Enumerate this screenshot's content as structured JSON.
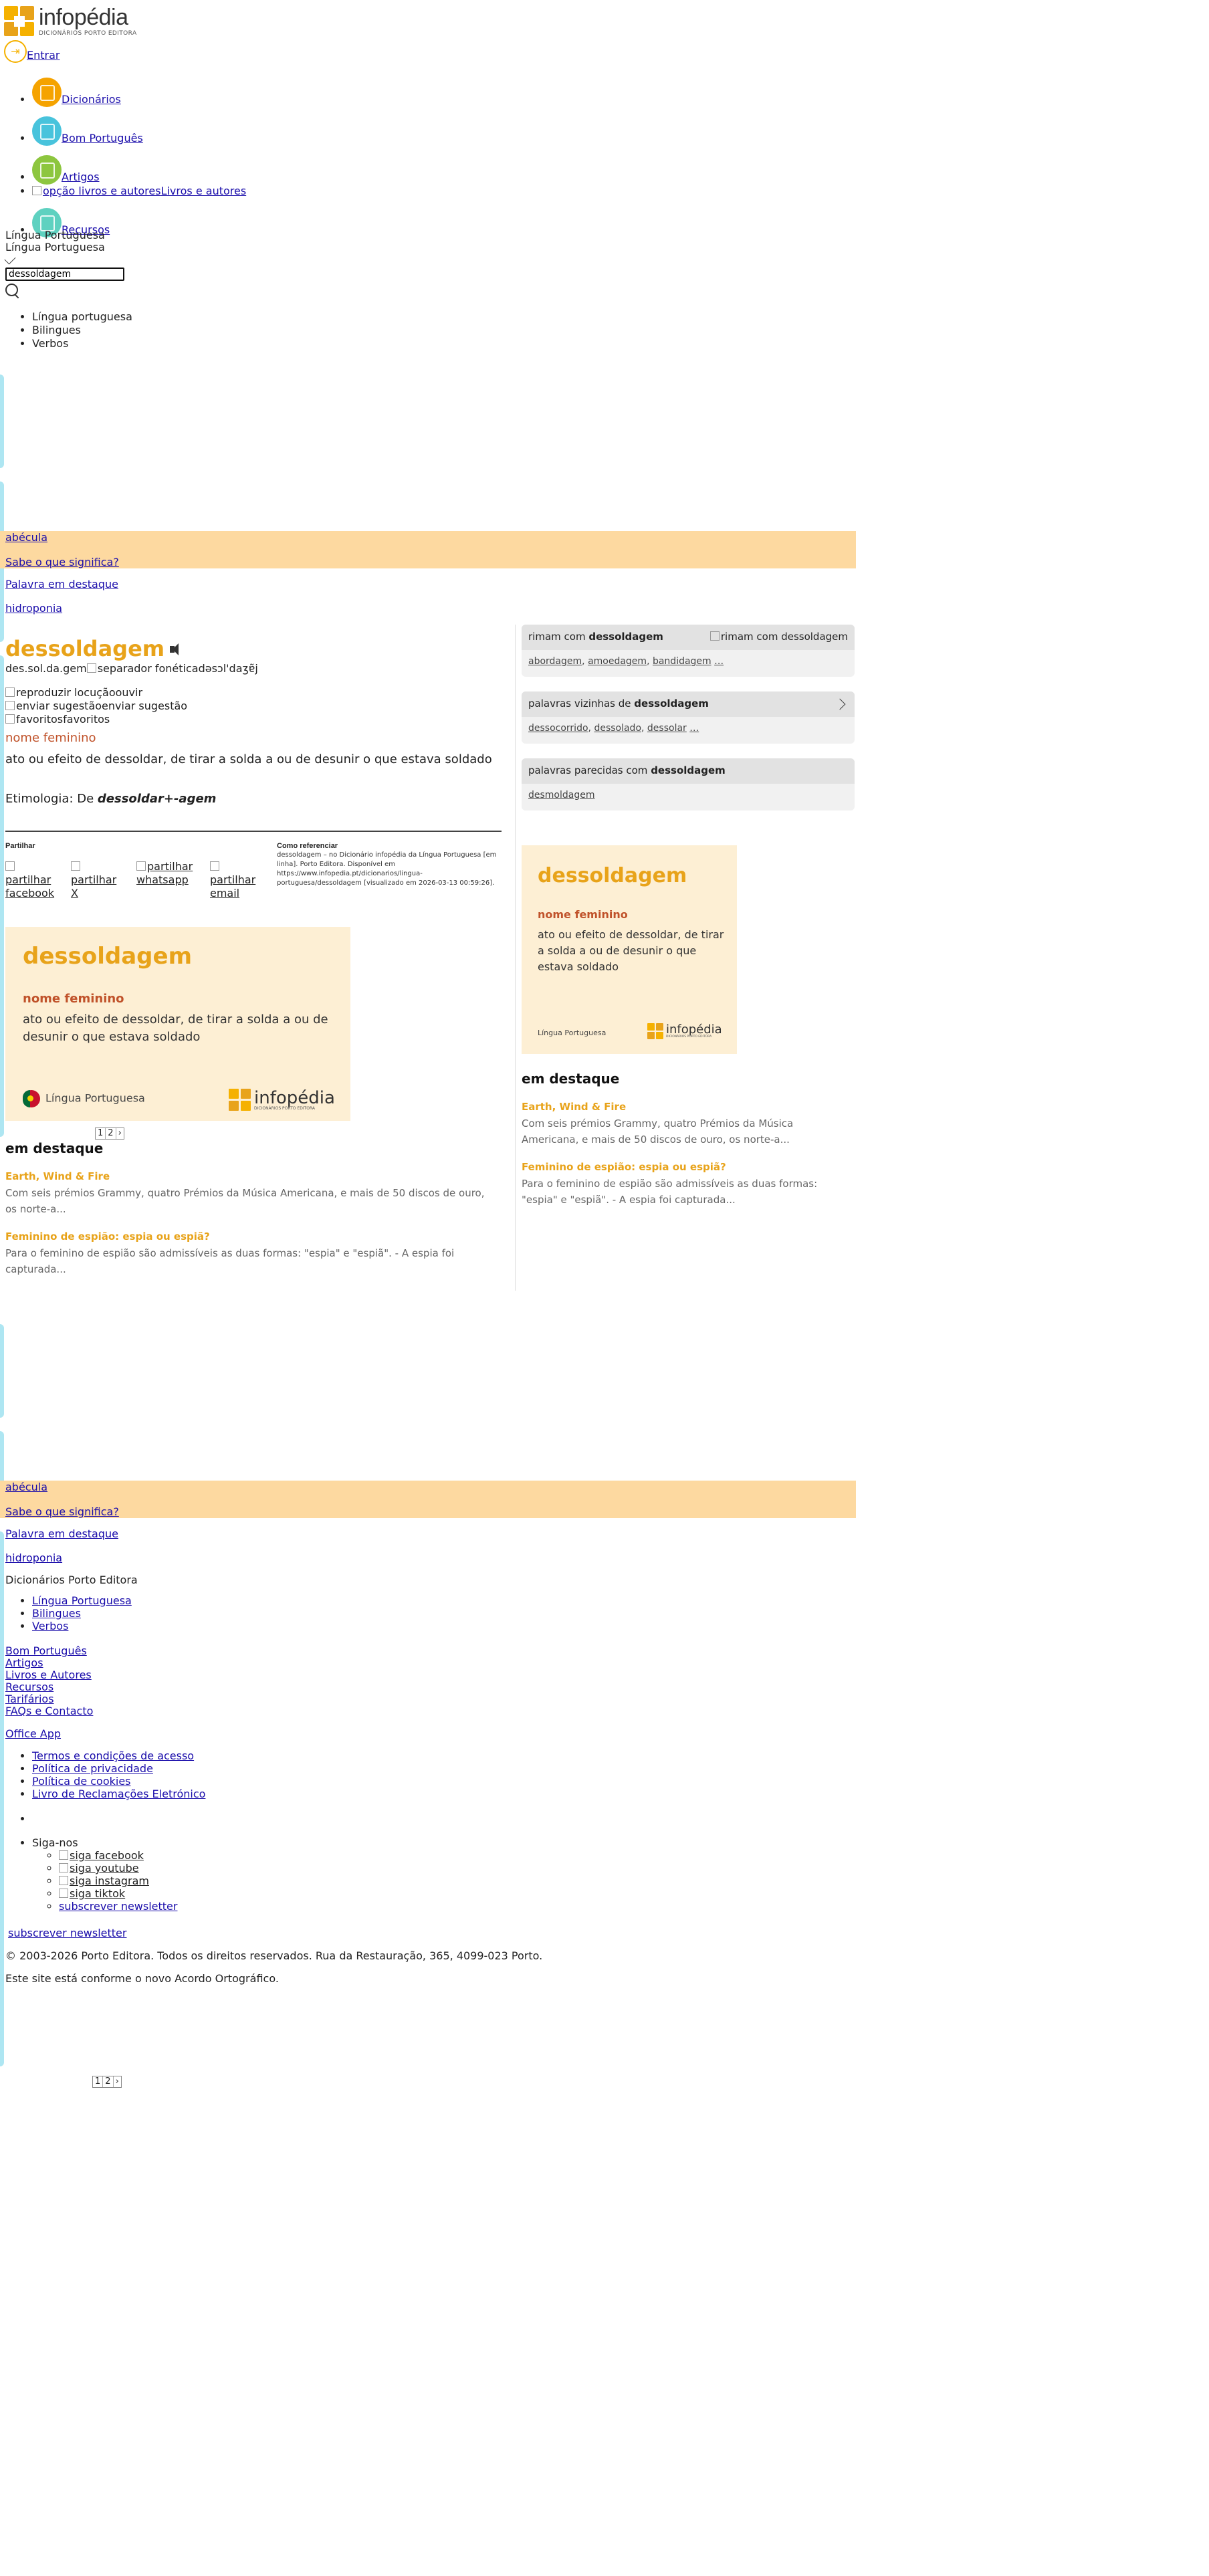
{
  "brand": {
    "name": "infopédia",
    "tagline": "DICIONÁRIOS PORTO EDITORA",
    "colors": {
      "yellow": "#f5b100",
      "orange": "#e8a31a",
      "red": "#c0522a",
      "promo": "#fdd9a0",
      "card": "#fdefd4"
    }
  },
  "header": {
    "login_label": "Entrar",
    "nav": [
      {
        "label": "Dicionários",
        "icon": "dictionaries-icon",
        "color": "#f5a300"
      },
      {
        "label": "Bom Português",
        "icon": "good-portuguese-icon",
        "color": "#48c3dc"
      },
      {
        "label": "Artigos",
        "icon": "articles-icon",
        "color": "#8dc63f"
      },
      {
        "label": "Livros e autores",
        "icon_alt": "opção livros e autores"
      },
      {
        "label": "Recursos",
        "icon": "resources-icon",
        "color": "#5ed1c0"
      }
    ],
    "lang_selected": "Língua Portuguesa",
    "lang_selected_2": "Língua Portuguesa",
    "search_value": "dessoldagem",
    "dict_options": [
      "Língua portuguesa",
      "Bilingues",
      "Verbos"
    ]
  },
  "promo": {
    "word": "abécula",
    "question": "Sabe o que significa?",
    "featured_label": "Palavra em destaque",
    "featured_word": "hidroponia"
  },
  "entry": {
    "headword": "dessoldagem",
    "syllables": "des.sol.da.gem",
    "phonetic_sep_alt": "separador fonética",
    "phonetic": "dəsɔl'daʒɐ̃j",
    "play_alt": "reproduzir locução",
    "play_label": "ouvir",
    "suggest_alt": "enviar sugestão",
    "suggest_label": "enviar sugestão",
    "fav_alt": "favoritos",
    "fav_label": "favoritos",
    "pos": "nome feminino",
    "definition": "ato ou efeito de dessoldar, de tirar a solda a ou de desunir o que estava soldado",
    "etym_prefix": "Etimologia: De ",
    "etym_value": "dessoldar+-agem"
  },
  "share": {
    "title": "Partilhar",
    "items": [
      "partilhar facebook",
      "partilhar X",
      "partilhar whatsapp",
      "partilhar email"
    ]
  },
  "cite": {
    "title": "Como referenciar",
    "text": "dessoldagem – no Dicionário infopédia da Língua Portuguesa [em linha]. Porto Editora. Disponível em https://www.infopedia.pt/dicionarios/lingua-portuguesa/dessoldagem [visualizado em 2026-03-13 00:59:26]."
  },
  "card": {
    "word": "dessoldagem",
    "pos": "nome feminino",
    "definition": "ato ou efeito de dessoldar, de tirar a solda a ou de desunir o que estava soldado",
    "lang": "Língua Portuguesa",
    "logo_word": "infopédia",
    "logo_sub": "DICIONÁRIOS PORTO EDITORA"
  },
  "pager": [
    "1",
    "2",
    "›"
  ],
  "highlights": {
    "title": "em destaque",
    "items": [
      {
        "title": "Earth, Wind & Fire",
        "text": "Com seis prémios Grammy, quatro Prémios da Música Americana, e mais de 50 discos de ouro, os norte-a..."
      },
      {
        "title": "Feminino de espião: espia ou espiã?",
        "text": "Para o feminino de espião são admissíveis as duas formas: \"espia\" e \"espiã\". - A espia foi capturada..."
      }
    ]
  },
  "sidebar": {
    "rhymes": {
      "prefix": "rimam com ",
      "word": "dessoldagem",
      "img_alt": "rimam com dessoldagem",
      "items": [
        "abordagem",
        "amoedagem",
        "bandidagem"
      ],
      "more": "…"
    },
    "neighbors": {
      "prefix": "palavras vizinhas de ",
      "word": "dessoldagem",
      "items": [
        "dessocorrido",
        "dessolado",
        "dessolar"
      ],
      "more": "…"
    },
    "similar": {
      "prefix": "palavras parecidas com ",
      "word": "dessoldagem",
      "items": [
        "desmoldagem"
      ]
    }
  },
  "footer": {
    "title": "Dicionários Porto Editora",
    "dicts": [
      "Língua Portuguesa",
      "Bilingues",
      "Verbos"
    ],
    "links": [
      "Bom Português",
      "Artigos",
      "Livros e Autores",
      "Recursos",
      "Tarifários",
      "FAQs e Contacto"
    ],
    "office": "Office App",
    "legal": [
      "Termos e condições de acesso",
      "Política de privacidade",
      "Política de cookies",
      "Livro de Reclamações Eletrónico"
    ],
    "follow": "Siga-nos",
    "social": [
      "siga facebook",
      "siga youtube",
      "siga instagram",
      "siga tiktok"
    ],
    "newsletter": "subscrever newsletter",
    "newsletter2": "subscrever newsletter",
    "copyright": "© 2003-2026 Porto Editora. Todos os direitos reservados. Rua da Restauração, 365, 4099-023 Porto.",
    "ao": "Este site está conforme o novo Acordo Ortográfico."
  }
}
